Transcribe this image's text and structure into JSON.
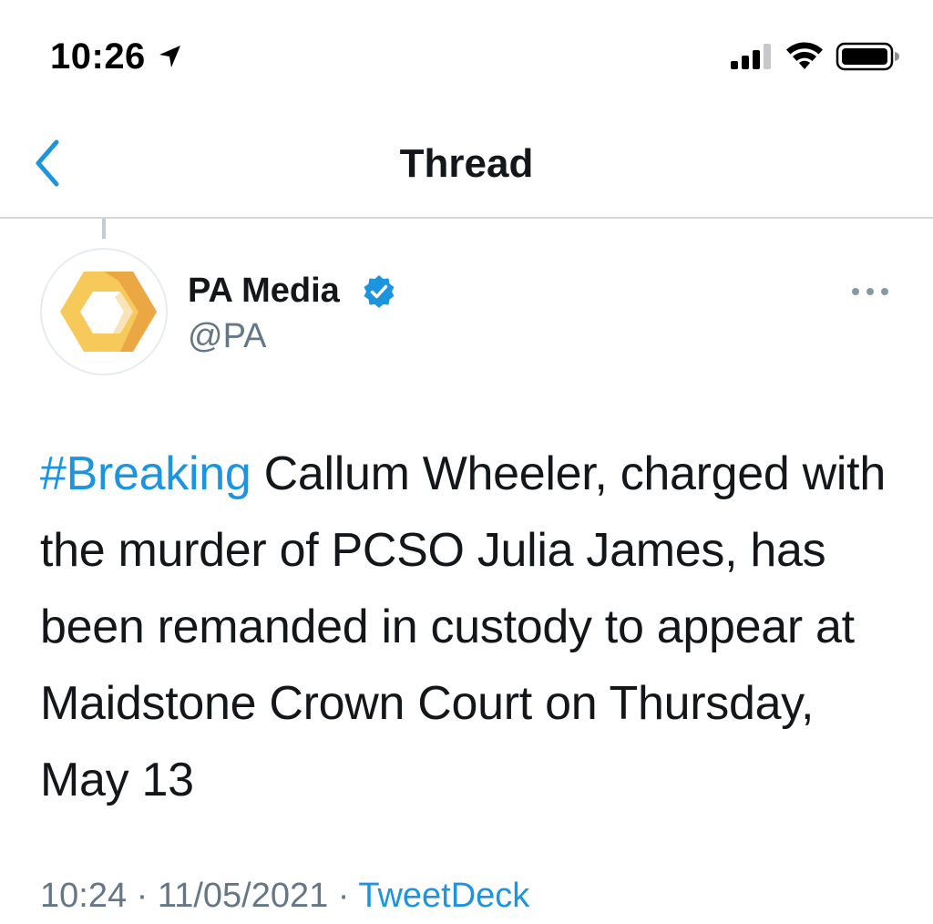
{
  "status_bar": {
    "time": "10:26",
    "location_icon": "location-arrow-icon",
    "signal_icon": "cellular-signal-icon",
    "wifi_icon": "wifi-icon",
    "battery_icon": "battery-icon"
  },
  "nav": {
    "back_icon": "chevron-left-icon",
    "title": "Thread"
  },
  "tweet": {
    "author": {
      "name": "PA Media",
      "handle": "@PA",
      "verified": true,
      "avatar_icon": "pa-media-logo"
    },
    "more_icon": "more-options-icon",
    "hashtag": "#Breaking",
    "text": " Callum Wheeler, charged with the murder of PCSO Julia James, has been remanded in custody to appear at Maidstone Crown Court on Thursday, May 13",
    "time": "10:24",
    "separator1": " · ",
    "date": "11/05/2021",
    "separator2": " · ",
    "source": "TweetDeck"
  },
  "colors": {
    "accent": "#1b95e0",
    "text_primary": "#14171a",
    "text_secondary": "#657786",
    "divider": "#d6d9dc",
    "logo_yellow": "#f6c95a",
    "logo_orange": "#eba744"
  }
}
